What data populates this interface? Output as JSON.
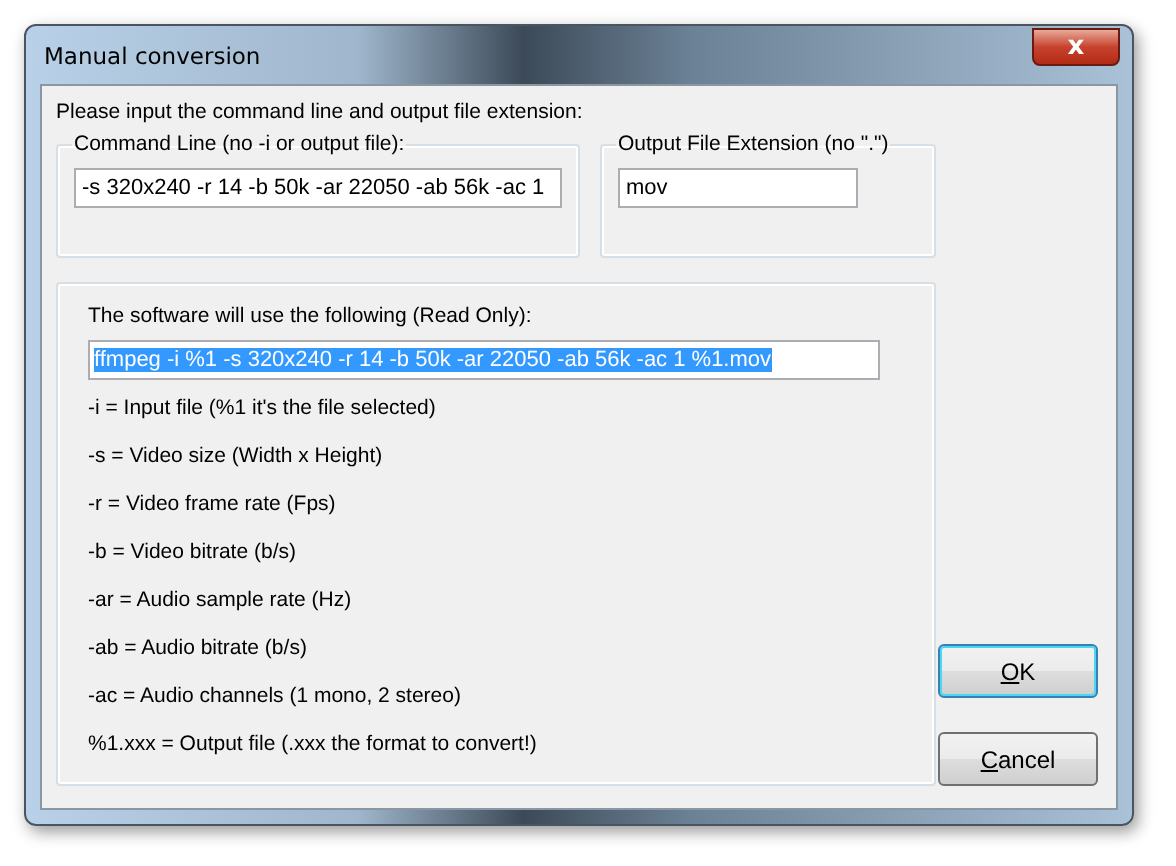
{
  "window": {
    "title": "Manual conversion",
    "close_label": "x"
  },
  "prompt": "Please input the command line and output file extension:",
  "command_line": {
    "label": "Command Line (no -i or output file):",
    "value": "-s 320x240 -r 14 -b 50k -ar 22050 -ab 56k -ac 1"
  },
  "extension": {
    "label": "Output File Extension (no \".\")",
    "value": "mov"
  },
  "preview": {
    "label": "The software will use the following (Read Only):",
    "value": "ffmpeg -i %1 -s 320x240 -r 14 -b 50k -ar 22050 -ab 56k -ac 1 %1.mov",
    "selected": true
  },
  "help_lines": [
    "-i = Input file (%1 it's the file selected)",
    "-s = Video size (Width x Height)",
    "-r = Video frame rate (Fps)",
    "-b = Video bitrate (b/s)",
    "-ar = Audio sample rate (Hz)",
    "-ab = Audio bitrate (b/s)",
    "-ac = Audio channels (1 mono, 2 stereo)",
    "%1.xxx = Output file (.xxx the format to convert!)"
  ],
  "buttons": [
    {
      "label": "OK",
      "default": true
    },
    {
      "label": "Cancel",
      "default": false
    }
  ]
}
